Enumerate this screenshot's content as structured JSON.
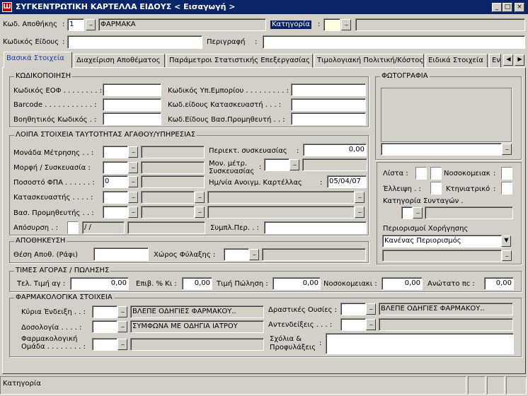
{
  "window": {
    "title": "ΣΥΓΚΕΝΤΡΩΤΙΚΗ ΚΑΡΤΕΛΛΑ ΕΙΔΟΥΣ < Εισαγωγή >",
    "minimize": "_",
    "maximize": "□",
    "close": "×"
  },
  "header": {
    "warehouse_label": "Κωδ. Αποθήκης",
    "warehouse_value": "1",
    "warehouse_name": "ΦΑΡΜΑΚΑ",
    "category_label": "Κατηγορία",
    "item_code_label": "Κωδικός Είδους",
    "description_label": "Περιγραφή"
  },
  "tabs": [
    "Βασικά Στοιχεία",
    "Διαχείριση Αποθέματος",
    "Παράμετροι Στατιστικής Επεξεργασίας",
    "Τιμολογιακή Πολιτική/Κόστος",
    "Ειδικά Στοιχεία",
    "Εν"
  ],
  "coding": {
    "title": "ΚΩΔΙΚΟΠΟΙΗΣΗ",
    "eof": "Κωδικός ΕΟΦ . . . . . . . . :",
    "barcode": "Barcode . . . . . . . . . . . :",
    "aux": "Βοηθητικός Κωδικός . :",
    "supplier_code": "Κωδικός Υπ.Εμπορίου . . . . . . . . . :",
    "manufacturer_code": "Κωδ.είδους Κατασκευαστή . . . :",
    "main_supplier_code": "Κωδ.Είδους Βασ.Προμηθευτή . . :"
  },
  "photo": {
    "title": "ΦΩΤΟΓΡΑΦΙΑ"
  },
  "identity": {
    "title": "ΛΟΙΠΑ ΣΤΟΙΧΕΙΑ ΤΑΥΤΟΤΗΤΑΣ ΑΓΑΘΟΥ/ΥΠΗΡΕΣΙΑΣ",
    "unit": "Μονάδα Μέτρησης . . :",
    "form": "Μορφή / Συσκευασία :",
    "vat": "Ποσοστό ΦΠΑ . . . . . . :",
    "vat_value": "0",
    "manufacturer": "Κατασκευαστής . . . . :",
    "main_supplier": "Βασ. Προμηθευτής . . :",
    "withdrawal": "Απόσυρση . :",
    "withdrawal_date": "/ /",
    "pack_contents": "Περιεκτ. συσκευασίας",
    "pack_contents_value": "0,00",
    "pack_unit_1": "Μον. μέτρ.",
    "pack_unit_2": "Συσκευασίας",
    "open_date": "Ημ/νία Ανοιγμ. Καρτέλλας",
    "open_date_value": "05/04/07",
    "compl_per": "Συμπλ.Περ. . :"
  },
  "flags": {
    "list": "Λίστα :",
    "hospital": "Νοσοκομειακ",
    "shortage": "Έλλειψη . :",
    "veterinary": "Κτηνιατρικό",
    "recipe_category": "Κατηγορία Συνταγών .",
    "restrictions": "Περιορισμοί Χορήγησης",
    "restriction_value": "Κανένας Περιορισμός"
  },
  "storage": {
    "title": "ΑΠΟΘΗΚΕΥΣΗ",
    "shelf": "Θέση Αποθ. (Ράφι)",
    "area": "Χώρος Φύλαξης :"
  },
  "prices": {
    "title": "ΤΙΜΕΣ ΑΓΟΡΑΣ / ΠΩΛΗΣΗΣ",
    "buy_label": "Τελ. Τιμή αγ :",
    "buy_value": "0,00",
    "markup_label": "Επιβ. % Κι :",
    "markup_value": "0,00",
    "sell_label": "Τιμή Πώληση :",
    "sell_value": "0,00",
    "hospital_label": "Νοσοκομειακι :",
    "hospital_value": "0,00",
    "max_label": "Ανώτατο πc :",
    "max_value": "0,00"
  },
  "pharma": {
    "title": "ΦΑΡΜΑΚΟΛΟΓΙΚΑ ΣΤΟΙΧΕΙΑ",
    "indication": "Κύρια Ένδειξη . . :",
    "indication_value": "ΒΛΕΠΕ ΟΔΗΓΙΕΣ ΦΑΡΜΑΚΟΥ..",
    "dosage": "Δοσολογία . . . . :",
    "dosage_value": "ΣΥΜΦΩΝΑ ΜΕ ΟΔΗΓΙΑ ΙΑΤΡΟΥ",
    "group_1": "Φαρμακολογική",
    "group_2": "Ομάδα . . . . . . . . :",
    "active": "Δραστικές Ουσίες :",
    "active_value": "ΒΛΕΠΕ ΟΔΗΓΙΕΣ ΦΑΡΜΑΚΟΥ..",
    "contra": "Αντενδείξεις . . . :",
    "comments_1": "Σχόλια &",
    "comments_2": "Προφυλάξεις"
  },
  "status": {
    "text": "Κατηγορία"
  },
  "buttons": {
    "lookup": "...",
    "left": "◀",
    "right": "▶",
    "dropdown": "▼"
  }
}
